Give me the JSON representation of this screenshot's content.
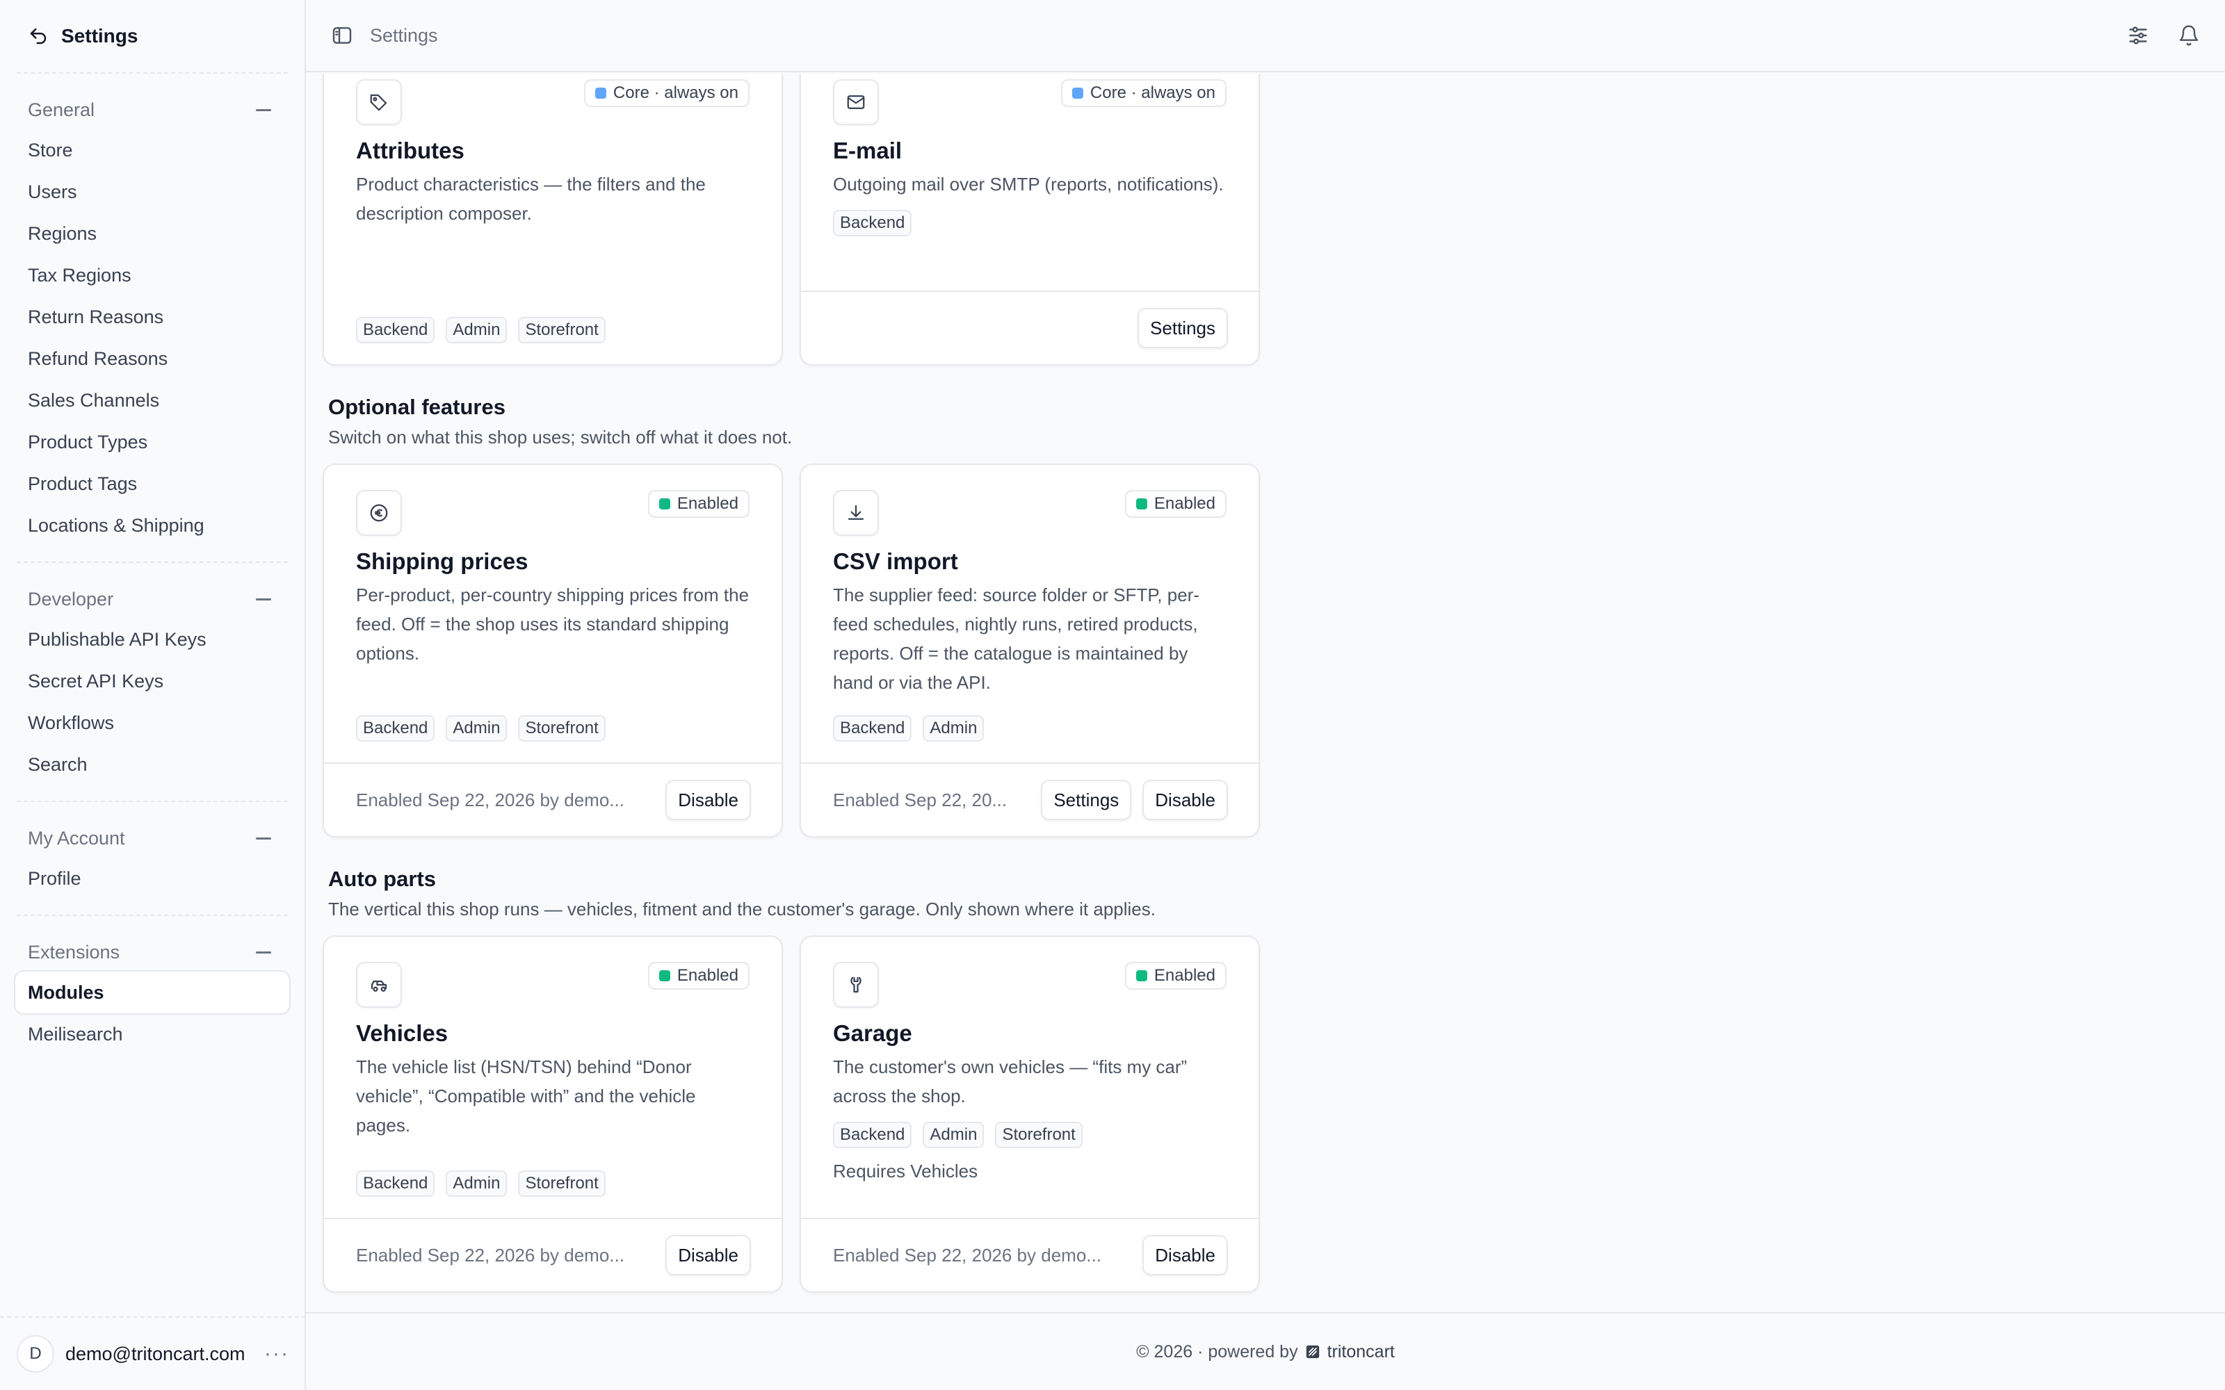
{
  "sidebar": {
    "title": "Settings",
    "groups": [
      {
        "label": "General",
        "items": [
          "Store",
          "Users",
          "Regions",
          "Tax Regions",
          "Return Reasons",
          "Refund Reasons",
          "Sales Channels",
          "Product Types",
          "Product Tags",
          "Locations & Shipping"
        ]
      },
      {
        "label": "Developer",
        "items": [
          "Publishable API Keys",
          "Secret API Keys",
          "Workflows",
          "Search"
        ]
      },
      {
        "label": "My Account",
        "items": [
          "Profile"
        ]
      },
      {
        "label": "Extensions",
        "items": [
          "Modules",
          "Meilisearch"
        ],
        "active_item": "Modules"
      }
    ],
    "user": {
      "initial": "D",
      "email": "demo@tritoncart.com",
      "more": "···"
    }
  },
  "topbar": {
    "breadcrumb": "Settings"
  },
  "core_cards": [
    {
      "title": "Attributes",
      "icon": "tag-icon",
      "status": "Core · always on",
      "description": "Product characteristics — the filters and the description composer.",
      "tags": [
        "Backend",
        "Admin",
        "Storefront"
      ]
    },
    {
      "title": "E-mail",
      "icon": "mail-icon",
      "status": "Core · always on",
      "description": "Outgoing mail over SMTP (reports, notifications).",
      "tags": [
        "Backend"
      ],
      "settings_label": "Settings"
    }
  ],
  "sections": [
    {
      "title": "Optional features",
      "subtitle": "Switch on what this shop uses; switch off what it does not.",
      "cards": [
        {
          "title": "Shipping prices",
          "icon": "euro-icon",
          "status": "Enabled",
          "description": "Per-product, per-country shipping prices from the feed. Off = the shop uses its standard shipping options.",
          "tags": [
            "Backend",
            "Admin",
            "Storefront"
          ],
          "meta": "Enabled Sep 22, 2026 by demo...",
          "disable_label": "Disable"
        },
        {
          "title": "CSV import",
          "icon": "download-icon",
          "status": "Enabled",
          "description": "The supplier feed: source folder or SFTP, per-feed schedules, nightly runs, retired products, reports. Off = the catalogue is maintained by hand or via the API.",
          "tags": [
            "Backend",
            "Admin"
          ],
          "meta": "Enabled Sep 22, 20...",
          "settings_label": "Settings",
          "disable_label": "Disable"
        }
      ]
    },
    {
      "title": "Auto parts",
      "subtitle": "The vertical this shop runs — vehicles, fitment and the customer's garage. Only shown where it applies.",
      "cards": [
        {
          "title": "Vehicles",
          "icon": "car-icon",
          "status": "Enabled",
          "description": "The vehicle list (HSN/TSN) behind “Donor vehicle”, “Compatible with” and the vehicle pages.",
          "tags": [
            "Backend",
            "Admin",
            "Storefront"
          ],
          "meta": "Enabled Sep 22, 2026 by demo...",
          "disable_label": "Disable"
        },
        {
          "title": "Garage",
          "icon": "wrench-icon",
          "status": "Enabled",
          "description": "The customer's own vehicles — “fits my car” across the shop.",
          "tags": [
            "Backend",
            "Admin",
            "Storefront"
          ],
          "requires": "Requires Vehicles",
          "meta": "Enabled Sep 22, 2026 by demo...",
          "disable_label": "Disable"
        }
      ]
    }
  ],
  "footer": {
    "text": "© 2026 · powered by",
    "brand": "tritoncart"
  },
  "colors": {
    "core_dot": "#60a5fa",
    "enabled_dot": "#10b981"
  }
}
